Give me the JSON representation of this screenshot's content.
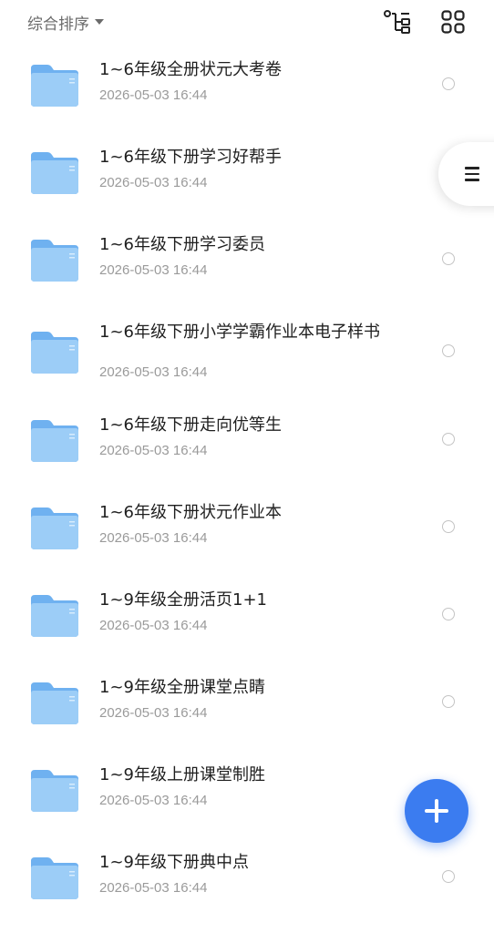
{
  "toolbar": {
    "sort_label": "综合排序",
    "tree_icon": "tree-view-icon",
    "grid_icon": "grid-view-icon"
  },
  "colors": {
    "accent": "#3b7cf0",
    "folder_light": "#9ccdf7",
    "folder_dark": "#6fb1f0"
  },
  "files": [
    {
      "name": "1~6年级全册状元大考卷",
      "date": "2026-05-03 16:44"
    },
    {
      "name": "1~6年级下册学习好帮手",
      "date": "2026-05-03 16:44"
    },
    {
      "name": "1~6年级下册学习委员",
      "date": "2026-05-03 16:44"
    },
    {
      "name": "1~6年级下册小学学霸作业本电子样书",
      "date": "2026-05-03 16:44"
    },
    {
      "name": "1~6年级下册走向优等生",
      "date": "2026-05-03 16:44"
    },
    {
      "name": "1~6年级下册状元作业本",
      "date": "2026-05-03 16:44"
    },
    {
      "name": "1~9年级全册活页1+1",
      "date": "2026-05-03 16:44"
    },
    {
      "name": "1~9年级全册课堂点睛",
      "date": "2026-05-03 16:44"
    },
    {
      "name": "1~9年级上册课堂制胜",
      "date": "2026-05-03 16:44"
    },
    {
      "name": "1~9年级下册典中点",
      "date": "2026-05-03 16:44"
    }
  ],
  "side_handle_icon": "menu-icon",
  "fab_icon": "plus-icon"
}
